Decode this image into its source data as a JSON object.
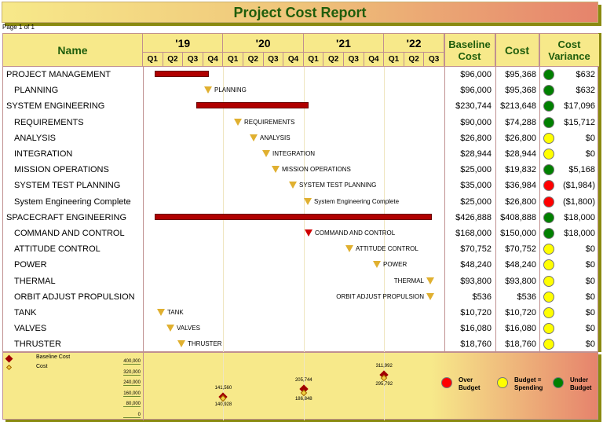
{
  "title": "Project Cost Report",
  "page": "Page 1 of 1",
  "header": {
    "name": "Name",
    "years": [
      "'19",
      "'20",
      "'21",
      "'22"
    ],
    "quarters": [
      "Q1",
      "Q2",
      "Q3",
      "Q4",
      "Q1",
      "Q2",
      "Q3",
      "Q4",
      "Q1",
      "Q2",
      "Q3",
      "Q4",
      "Q1",
      "Q2",
      "Q3"
    ],
    "baseline": "Baseline Cost",
    "cost": "Cost",
    "variance": "Cost Variance"
  },
  "colors": {
    "over": "#ff0000",
    "equal": "#ffff00",
    "under": "#008000",
    "bar": "#b00000",
    "milestone": "#e0b030"
  },
  "rows": [
    {
      "name": "PROJECT MANAGEMENT",
      "indent": 0,
      "baseline": "$96,000",
      "cost": "$95,368",
      "status": "under",
      "variance": "$632"
    },
    {
      "name": "PLANNING",
      "indent": 1,
      "milestone": "PLANNING",
      "baseline": "$96,000",
      "cost": "$95,368",
      "status": "under",
      "variance": "$632"
    },
    {
      "name": "SYSTEM ENGINEERING",
      "indent": 0,
      "baseline": "$230,744",
      "cost": "$213,648",
      "status": "under",
      "variance": "$17,096"
    },
    {
      "name": "REQUIREMENTS",
      "indent": 1,
      "milestone": "REQUIREMENTS",
      "baseline": "$90,000",
      "cost": "$74,288",
      "status": "under",
      "variance": "$15,712"
    },
    {
      "name": "ANALYSIS",
      "indent": 1,
      "milestone": "ANALYSIS",
      "baseline": "$26,800",
      "cost": "$26,800",
      "status": "equal",
      "variance": "$0"
    },
    {
      "name": "INTEGRATION",
      "indent": 1,
      "milestone": "INTEGRATION",
      "baseline": "$28,944",
      "cost": "$28,944",
      "status": "equal",
      "variance": "$0"
    },
    {
      "name": "MISSION OPERATIONS",
      "indent": 1,
      "milestone": "MISSION OPERATIONS",
      "baseline": "$25,000",
      "cost": "$19,832",
      "status": "under",
      "variance": "$5,168"
    },
    {
      "name": "SYSTEM TEST PLANNING",
      "indent": 1,
      "milestone": "SYSTEM TEST PLANNING",
      "baseline": "$35,000",
      "cost": "$36,984",
      "status": "over",
      "variance": "($1,984)"
    },
    {
      "name": "System Engineering Complete",
      "indent": 1,
      "milestone": "System Engineering Complete",
      "baseline": "$25,000",
      "cost": "$26,800",
      "status": "over",
      "variance": "($1,800)"
    },
    {
      "name": "SPACECRAFT ENGINEERING",
      "indent": 0,
      "baseline": "$426,888",
      "cost": "$408,888",
      "status": "under",
      "variance": "$18,000"
    },
    {
      "name": "COMMAND AND CONTROL",
      "indent": 1,
      "milestone": "COMMAND AND CONTROL",
      "critical": true,
      "baseline": "$168,000",
      "cost": "$150,000",
      "status": "under",
      "variance": "$18,000"
    },
    {
      "name": "ATTITUDE CONTROL",
      "indent": 1,
      "milestone": "ATTITUDE CONTROL",
      "baseline": "$70,752",
      "cost": "$70,752",
      "status": "equal",
      "variance": "$0"
    },
    {
      "name": "POWER",
      "indent": 1,
      "milestone": "POWER",
      "baseline": "$48,240",
      "cost": "$48,240",
      "status": "equal",
      "variance": "$0"
    },
    {
      "name": "THERMAL",
      "indent": 1,
      "milestone": "THERMAL",
      "baseline": "$93,800",
      "cost": "$93,800",
      "status": "equal",
      "variance": "$0"
    },
    {
      "name": "ORBIT ADJUST PROPULSION",
      "indent": 1,
      "milestone": "ORBIT ADJUST PROPULSION",
      "baseline": "$536",
      "cost": "$536",
      "status": "equal",
      "variance": "$0"
    },
    {
      "name": "TANK",
      "indent": 1,
      "milestone": "TANK",
      "baseline": "$10,720",
      "cost": "$10,720",
      "status": "equal",
      "variance": "$0"
    },
    {
      "name": "VALVES",
      "indent": 1,
      "milestone": "VALVES",
      "baseline": "$16,080",
      "cost": "$16,080",
      "status": "equal",
      "variance": "$0"
    },
    {
      "name": "THRUSTER",
      "indent": 1,
      "milestone": "THRUSTER",
      "baseline": "$18,760",
      "cost": "$18,760",
      "status": "equal",
      "variance": "$0"
    }
  ],
  "footer": {
    "legend": {
      "baseline": "Baseline Cost",
      "cost": "Cost"
    },
    "axis_ticks": [
      "400,000",
      "320,000",
      "240,000",
      "160,000",
      "80,000",
      "0"
    ],
    "points": [
      {
        "year": "'19",
        "baseline": 141560,
        "baseline_label": "141,560",
        "cost": 140928,
        "cost_label": "140,928"
      },
      {
        "year": "'20",
        "baseline": 205744,
        "baseline_label": "205,744",
        "cost": 186848,
        "cost_label": "186,848"
      },
      {
        "year": "'21",
        "baseline": 311992,
        "baseline_label": "311,992",
        "cost": 295792,
        "cost_label": "295,792"
      }
    ],
    "status_legend": [
      {
        "key": "over",
        "label": "Over Budget"
      },
      {
        "key": "equal",
        "label": "Budget = Spending"
      },
      {
        "key": "under",
        "label": "Under Budget"
      }
    ]
  }
}
